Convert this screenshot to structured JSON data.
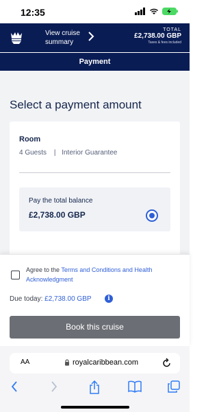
{
  "status_bar": {
    "time": "12:35"
  },
  "header": {
    "view_cruise": "View cruise summary",
    "total_label": "TOTAL",
    "total_amount": "£2,738.00 GBP",
    "total_note": "Taxes & fees included"
  },
  "subheader": {
    "title": "Payment"
  },
  "main": {
    "title": "Select a payment amount",
    "room": {
      "title": "Room",
      "guests": "4 Guests",
      "separator": "|",
      "cabin_type": "Interior Guarantee"
    },
    "payment_option": {
      "label": "Pay the total balance",
      "amount": "£2,738.00 GBP",
      "selected": true
    }
  },
  "bottom": {
    "agree_prefix": "Agree to the ",
    "agree_link": "Terms and Conditions and Health Acknowledgment",
    "due_label": "Due today: ",
    "due_amount": "£2,738.00 GBP",
    "info_glyph": "i",
    "book_button": "Book this cruise"
  },
  "browser": {
    "aa_label": "AA",
    "url": "royalcaribbean.com"
  },
  "colors": {
    "navy": "#0a1c54",
    "link_blue": "#2f5fd7",
    "button_gray": "#6b6e74"
  },
  "icons": [
    "royal-caribbean-logo",
    "chevron-right-icon",
    "radio-selected-icon",
    "info-icon",
    "lock-icon",
    "reload-icon",
    "back-icon",
    "forward-icon",
    "share-icon",
    "bookmarks-icon",
    "tabs-icon"
  ]
}
